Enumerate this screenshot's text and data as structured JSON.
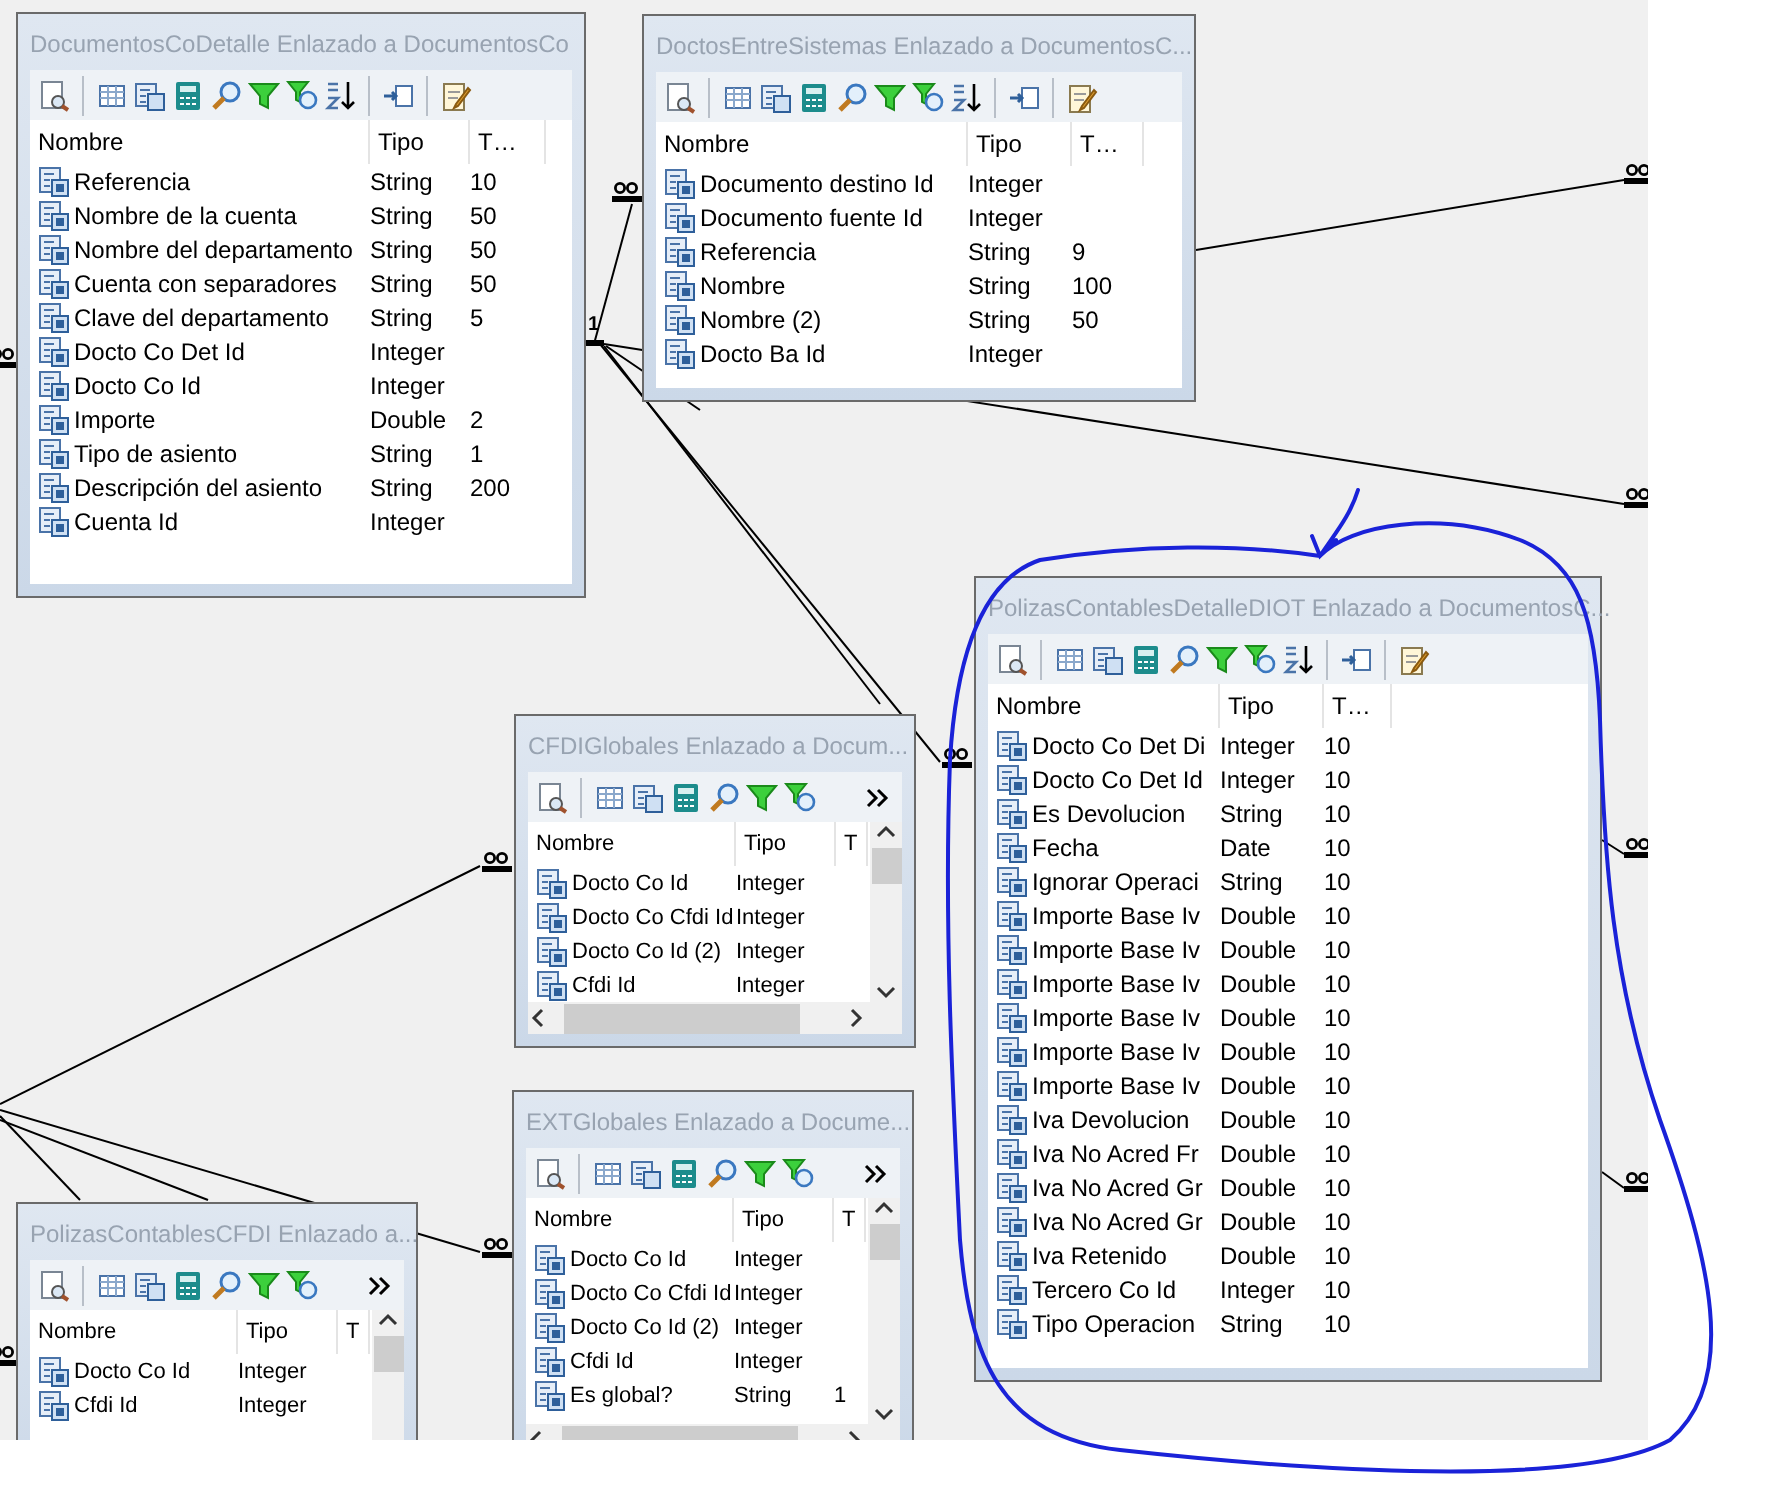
{
  "diagram": {
    "relation_label": "1",
    "tables": [
      {
        "title": "DocumentosCoDetalle Enlazado a DocumentosCo",
        "toolbar_overflow": false,
        "scrollbars": false,
        "columns": [
          "Nombre",
          "Tipo",
          "T…"
        ],
        "rows": [
          {
            "name": "Referencia",
            "type": "String",
            "length": "10"
          },
          {
            "name": "Nombre de la cuenta",
            "type": "String",
            "length": "50"
          },
          {
            "name": "Nombre del departamento",
            "type": "String",
            "length": "50"
          },
          {
            "name": "Cuenta con separadores",
            "type": "String",
            "length": "50"
          },
          {
            "name": "Clave del departamento",
            "type": "String",
            "length": "5"
          },
          {
            "name": "Docto Co Det Id",
            "type": "Integer"
          },
          {
            "name": "Docto Co Id",
            "type": "Integer"
          },
          {
            "name": "Importe",
            "type": "Double",
            "length": "2"
          },
          {
            "name": "Tipo de asiento",
            "type": "String",
            "length": "1"
          },
          {
            "name": "Descripción del asiento",
            "type": "String",
            "length": "200"
          },
          {
            "name": "Cuenta Id",
            "type": "Integer"
          }
        ]
      },
      {
        "title": "DoctosEntreSistemas Enlazado a DocumentosC...",
        "toolbar_overflow": false,
        "scrollbars": false,
        "columns": [
          "Nombre",
          "Tipo",
          "T…"
        ],
        "rows": [
          {
            "name": "Documento destino Id",
            "type": "Integer"
          },
          {
            "name": "Documento fuente Id",
            "type": "Integer"
          },
          {
            "name": "Referencia",
            "type": "String",
            "length": "9"
          },
          {
            "name": "Nombre",
            "type": "String",
            "length": "100"
          },
          {
            "name": "Nombre (2)",
            "type": "String",
            "length": "50"
          },
          {
            "name": "Docto Ba Id",
            "type": "Integer"
          }
        ]
      },
      {
        "title": "PolizasContablesDetalleDIOT Enlazado a DocumentosC...",
        "toolbar_overflow": false,
        "scrollbars": false,
        "columns": [
          "Nombre",
          "Tipo",
          "T…"
        ],
        "rows": [
          {
            "name": "Docto Co Det Di",
            "type": "Integer",
            "length": "10"
          },
          {
            "name": "Docto Co Det Id",
            "type": "Integer",
            "length": "10"
          },
          {
            "name": "Es Devolucion",
            "type": "String",
            "length": "10"
          },
          {
            "name": "Fecha",
            "type": "Date",
            "length": "10"
          },
          {
            "name": "Ignorar Operaci",
            "type": "String",
            "length": "10"
          },
          {
            "name": "Importe Base Iv",
            "type": "Double",
            "length": "10"
          },
          {
            "name": "Importe Base Iv",
            "type": "Double",
            "length": "10"
          },
          {
            "name": "Importe Base Iv",
            "type": "Double",
            "length": "10"
          },
          {
            "name": "Importe Base Iv",
            "type": "Double",
            "length": "10"
          },
          {
            "name": "Importe Base Iv",
            "type": "Double",
            "length": "10"
          },
          {
            "name": "Importe Base Iv",
            "type": "Double",
            "length": "10"
          },
          {
            "name": "Iva Devolucion",
            "type": "Double",
            "length": "10"
          },
          {
            "name": "Iva No Acred Fr",
            "type": "Double",
            "length": "10"
          },
          {
            "name": "Iva No Acred Gr",
            "type": "Double",
            "length": "10"
          },
          {
            "name": "Iva No Acred Gr",
            "type": "Double",
            "length": "10"
          },
          {
            "name": "Iva Retenido",
            "type": "Double",
            "length": "10"
          },
          {
            "name": "Tercero Co Id",
            "type": "Integer",
            "length": "10"
          },
          {
            "name": "Tipo Operacion",
            "type": "String",
            "length": "10"
          }
        ]
      },
      {
        "title": "CFDIGlobales Enlazado a Docum...",
        "toolbar_overflow": true,
        "scrollbars": true,
        "columns": [
          "Nombre",
          "Tipo",
          "T"
        ],
        "rows": [
          {
            "name": "Docto Co Id",
            "type": "Integer"
          },
          {
            "name": "Docto Co Cfdi Id",
            "type": "Integer"
          },
          {
            "name": "Docto Co Id (2)",
            "type": "Integer"
          },
          {
            "name": "Cfdi Id",
            "type": "Integer"
          }
        ]
      },
      {
        "title": "PolizasContablesCFDI Enlazado a...",
        "toolbar_overflow": true,
        "scrollbars": true,
        "columns": [
          "Nombre",
          "Tipo",
          "T"
        ],
        "rows": [
          {
            "name": "Docto Co Id",
            "type": "Integer"
          },
          {
            "name": "Cfdi Id",
            "type": "Integer"
          }
        ]
      },
      {
        "title": "EXTGlobales Enlazado a Docume...",
        "toolbar_overflow": true,
        "scrollbars": true,
        "columns": [
          "Nombre",
          "Tipo",
          "T"
        ],
        "rows": [
          {
            "name": "Docto Co Id",
            "type": "Integer"
          },
          {
            "name": "Docto Co Cfdi Id",
            "type": "Integer"
          },
          {
            "name": "Docto Co Id (2)",
            "type": "Integer"
          },
          {
            "name": "Cfdi Id",
            "type": "Integer"
          },
          {
            "name": "Es global?",
            "type": "String",
            "length": "1"
          }
        ]
      }
    ]
  }
}
